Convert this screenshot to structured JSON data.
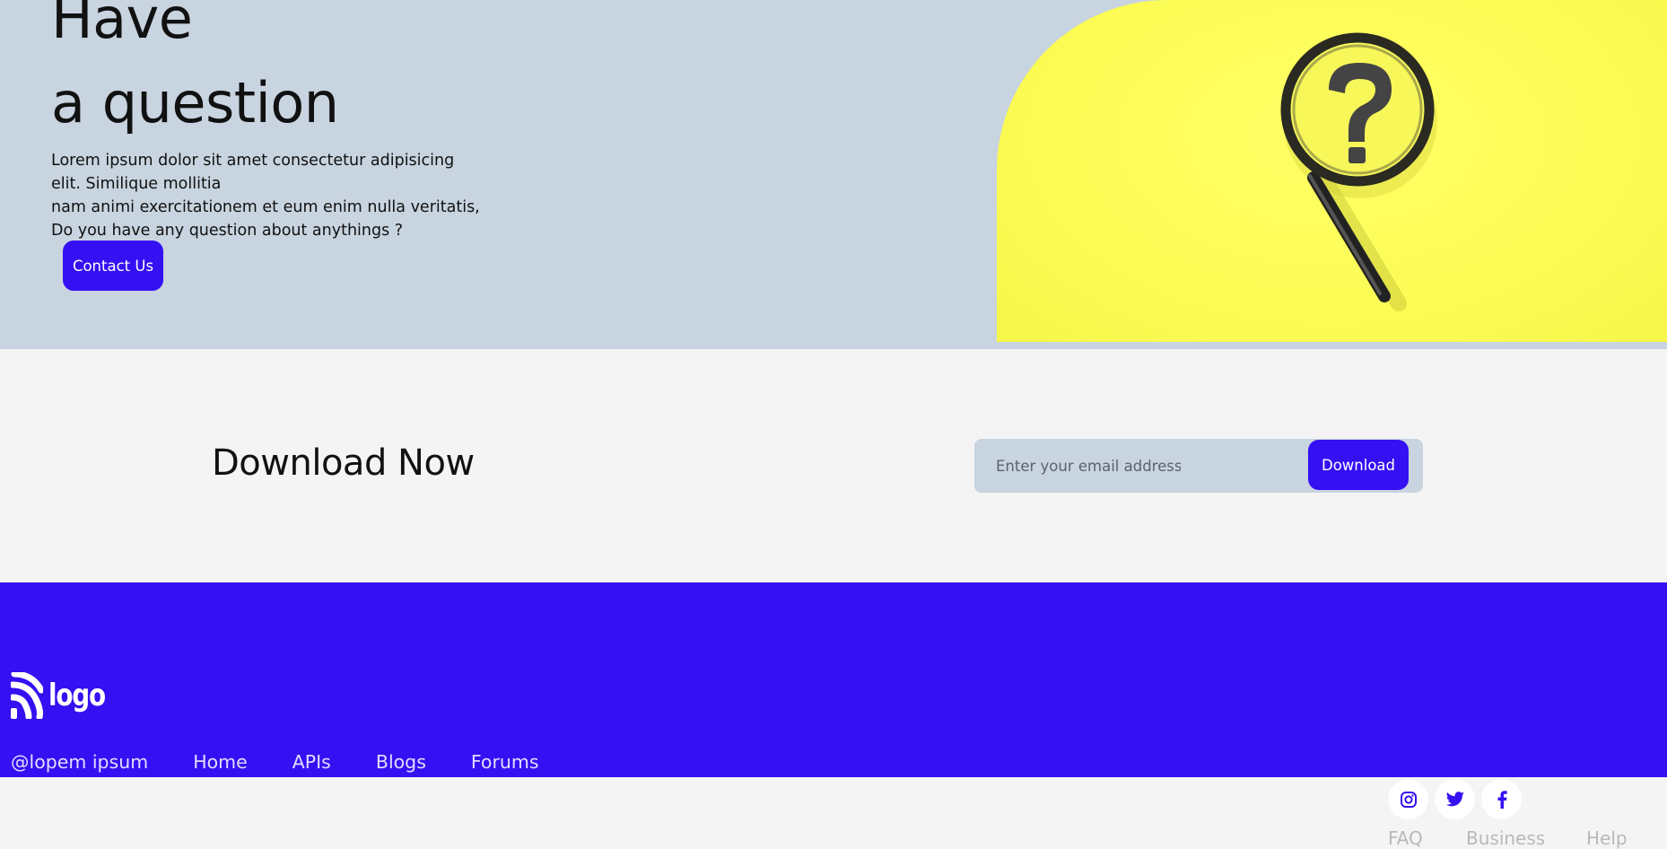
{
  "hero": {
    "title_line1": "Have",
    "title_line2": "a question",
    "description_lines": [
      "Lorem ipsum dolor sit amet consectetur adipisicing",
      "elit. Similique mollitia",
      "nam animi exercitationem et eum enim nulla veritatis,",
      "Do you have any question about anythings ?"
    ],
    "contact_button": "Contact Us",
    "image_icon": "magnifying-glass-question-icon"
  },
  "download": {
    "title": "Download Now",
    "email_placeholder": "Enter your email address",
    "button_label": "Download"
  },
  "footer": {
    "logo_text": "logo",
    "copyright": "@lopem ipsum",
    "links": [
      "Home",
      "APIs",
      "Blogs",
      "Forums"
    ]
  },
  "bottom": {
    "social_icons": [
      "instagram-icon",
      "twitter-icon",
      "facebook-icon"
    ],
    "links": [
      "FAQ",
      "Business",
      "Help"
    ]
  },
  "colors": {
    "accent": "#3510f2",
    "hero_bg": "#c8d4e0",
    "page_bg": "#f4f4f4",
    "highlight_yellow": "#fcfc55"
  }
}
